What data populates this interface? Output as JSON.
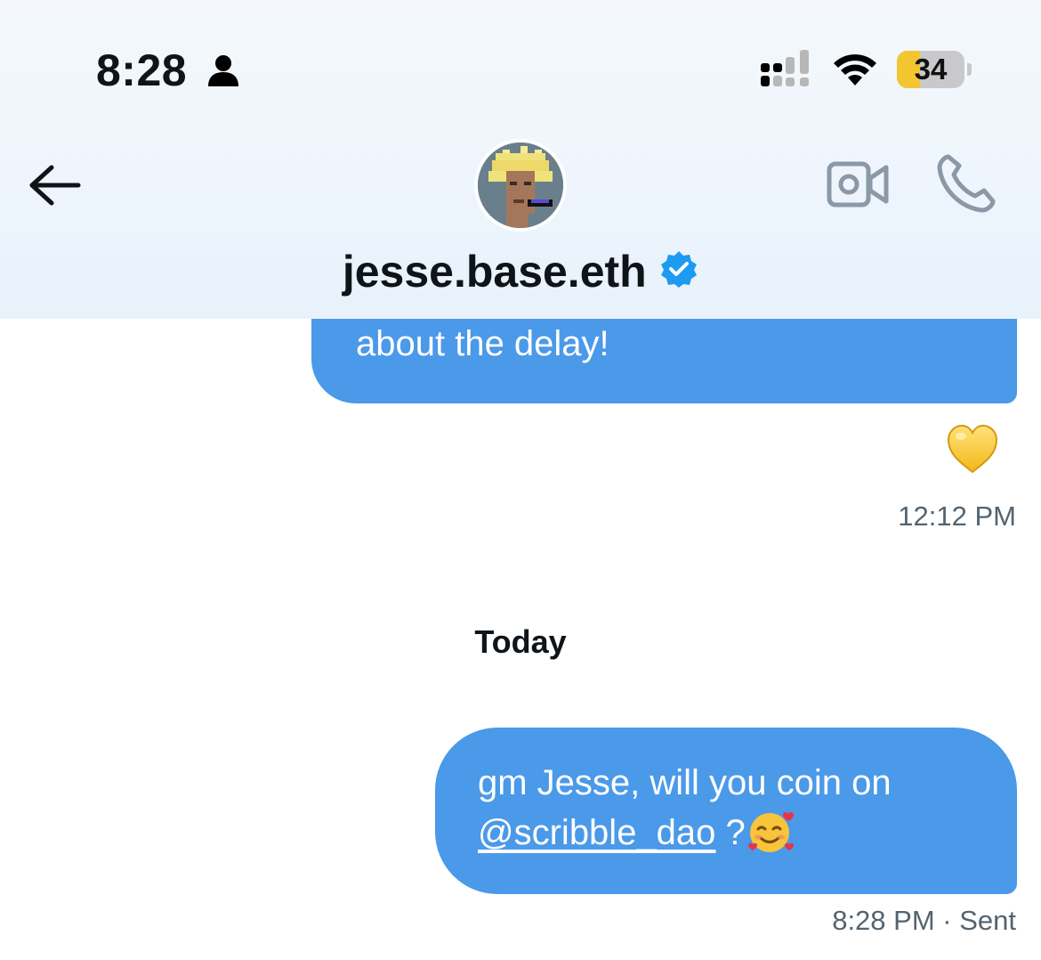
{
  "status_bar": {
    "time": "8:28",
    "battery": "34",
    "battery_level": 0.34,
    "icons": [
      "person-icon",
      "cellular-signal-icon",
      "wifi-icon",
      "battery-icon"
    ]
  },
  "header": {
    "back_icon": "arrow-left-icon",
    "contact_name": "jesse.base.eth",
    "verified_icon": "verified-badge-icon",
    "video_call_icon": "video-camera-icon",
    "phone_icon": "phone-icon"
  },
  "conversation": {
    "previous_message": {
      "text": "about the delay!",
      "reaction": "yellow-heart",
      "timestamp": "12:12 PM"
    },
    "date_divider": "Today",
    "latest_message": {
      "text_line1": "gm Jesse, will you coin on",
      "mention": "@scribble_dao",
      "suffix": "?",
      "emoji": "smiling-face-with-hearts",
      "timestamp": "8:28 PM",
      "status": "· Sent"
    }
  },
  "colors": {
    "bubble": "#4b99e9",
    "verified": "#1d9bf0",
    "battery_fill": "#f2c531",
    "muted_text": "#536471"
  }
}
